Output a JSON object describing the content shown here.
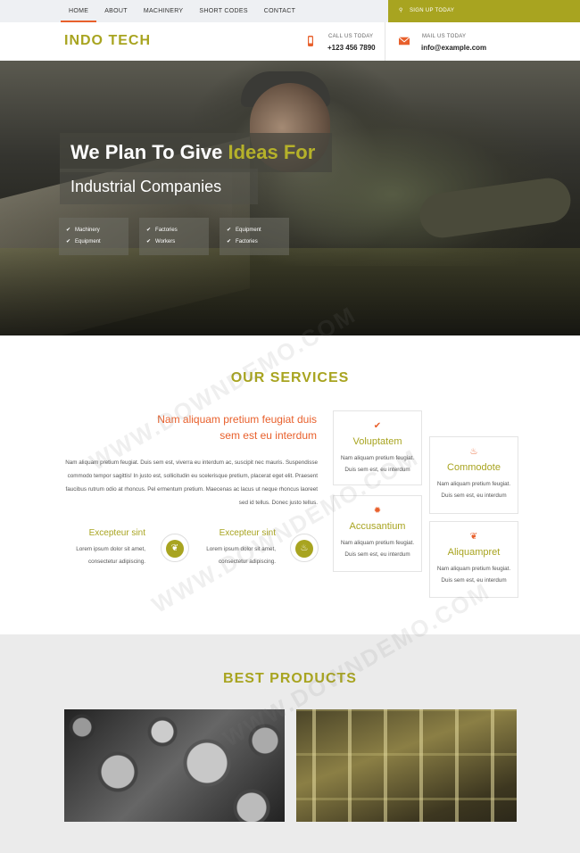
{
  "nav": {
    "items": [
      {
        "label": "HOME",
        "active": true
      },
      {
        "label": "ABOUT"
      },
      {
        "label": "MACHINERY"
      },
      {
        "label": "SHORT CODES"
      },
      {
        "label": "CONTACT"
      }
    ],
    "signup_label": "SIGN UP TODAY"
  },
  "header": {
    "logo": "INDO TECH",
    "call_label": "CALL US TODAY",
    "call_value": "+123 456 7890",
    "mail_label": "MAIL US TODAY",
    "mail_value": "info@example.com"
  },
  "hero": {
    "title_part1": "We Plan To Give ",
    "title_highlight": "Ideas For",
    "subtitle": "Industrial Companies",
    "lists": [
      [
        "Machinery",
        "Equipment"
      ],
      [
        "Factories",
        "Workers"
      ],
      [
        "Equipment",
        "Factories"
      ]
    ]
  },
  "services": {
    "title": "OUR SERVICES",
    "heading_line1": "Nam aliquam pretium feugiat duis",
    "heading_line2": "sem est eu interdum",
    "paragraph": "Nam aliquam pretium feugiat. Duis sem est, viverra eu interdum ac, suscipit nec mauris. Suspendisse commodo tempor sagittis! In justo est, sollicitudin eu scelerisque pretium, placerat eget elit. Praesent faucibus rutrum odio at rhoncus. Pel ermentum pretium. Maecenas ac lacus ut neque rhoncus laoreet sed id tellus. Donec justo tellus.",
    "features": [
      {
        "title": "Excepteur sint",
        "line1": "Lorem ipsum dolor sit amet,",
        "line2": "consectetur adipiscing."
      },
      {
        "title": "Excepteur sint",
        "line1": "Lorem ipsum dolor sit amet,",
        "line2": "consectetur adipiscing."
      }
    ],
    "cards": [
      {
        "title": "Voluptatem",
        "line1": "Nam aliquam pretium feugiat.",
        "line2": "Duis sem est, eu interdum"
      },
      {
        "title": "Commodote",
        "line1": "Nam aliquam pretium feugiat.",
        "line2": "Duis sem est, eu interdum"
      },
      {
        "title": "Accusantium",
        "line1": "Nam aliquam pretium feugiat.",
        "line2": "Duis sem est, eu interdum"
      },
      {
        "title": "Aliquampret",
        "line1": "Nam aliquam pretium feugiat.",
        "line2": "Duis sem est, eu interdum"
      }
    ]
  },
  "products": {
    "title": "BEST PRODUCTS"
  },
  "watermark": "WWW.DOWNDEMO.COM",
  "colors": {
    "accent": "#a8a420",
    "orange": "#e8602c"
  }
}
